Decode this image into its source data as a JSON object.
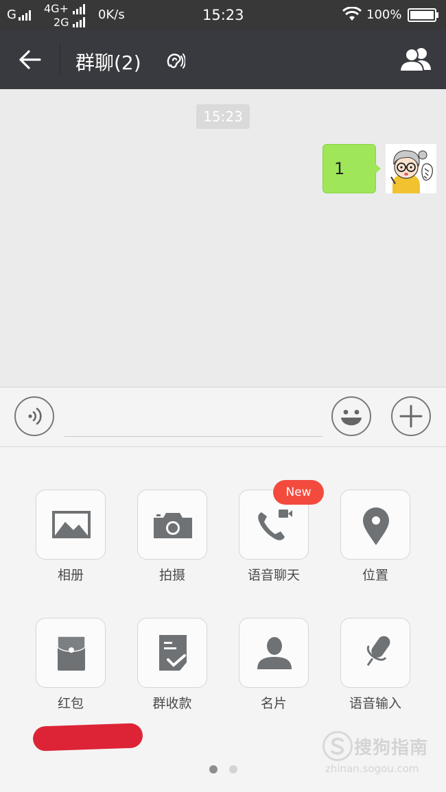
{
  "status_bar": {
    "carrier1": "G",
    "carrier2_top": "4G+",
    "carrier2_bottom": "2G",
    "speed": "0K/s",
    "time": "15:23",
    "battery": "100%"
  },
  "title_bar": {
    "title": "群聊(2)",
    "icons": [
      "back-arrow-icon",
      "earpiece-icon",
      "group-members-icon"
    ]
  },
  "chat": {
    "timestamp": "15:23",
    "messages": [
      {
        "direction": "outgoing",
        "text": "1",
        "bubble_color": "#9fe658"
      }
    ]
  },
  "input_bar": {
    "voice_icon": "voice-icon",
    "text_value": "",
    "emoji_icon": "emoji-icon",
    "more_icon": "plus-icon"
  },
  "tools_panel": {
    "row1": [
      {
        "label": "相册",
        "icon": "album-icon"
      },
      {
        "label": "拍摄",
        "icon": "camera-icon"
      },
      {
        "label": "语音聊天",
        "icon": "voice-video-call-icon",
        "badge": "New"
      },
      {
        "label": "位置",
        "icon": "location-pin-icon"
      }
    ],
    "row2": [
      {
        "label": "红包",
        "icon": "red-packet-icon"
      },
      {
        "label": "群收款",
        "icon": "group-receipt-icon"
      },
      {
        "label": "名片",
        "icon": "contact-card-icon"
      },
      {
        "label": "语音输入",
        "icon": "microphone-icon"
      }
    ],
    "page_indicator": {
      "pages": 2,
      "current": 1
    }
  },
  "watermark": {
    "title": "搜狗指南",
    "url": "zhinan.sogou.com"
  },
  "colors": {
    "title_bar": "#393a3f",
    "status_bar": "#383838",
    "chat_background": "#ebebeb",
    "new_badge": "#f24b3e",
    "icon_gray": "#6f7274",
    "red_mark": "#dd2436"
  }
}
